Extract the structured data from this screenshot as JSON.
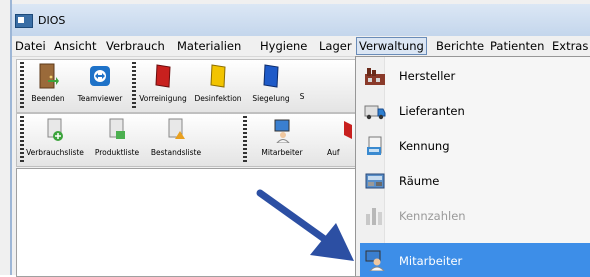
{
  "window": {
    "title": "DIOS"
  },
  "menubar": {
    "items": [
      {
        "label": "Datei"
      },
      {
        "label": "Ansicht"
      },
      {
        "label": "Verbrauch"
      },
      {
        "label": "Materialien"
      },
      {
        "label": "Hygiene"
      },
      {
        "label": "Lager"
      },
      {
        "label": "Verwaltung"
      },
      {
        "label": "Berichte"
      },
      {
        "label": "Patienten"
      },
      {
        "label": "Extras"
      }
    ],
    "active_index": 6
  },
  "toolbar1": {
    "buttons": [
      {
        "label": "Beenden",
        "icon": "door-exit-icon"
      },
      {
        "label": "Teamviewer",
        "icon": "teamviewer-icon"
      },
      {
        "label": "Vorreinigung",
        "icon": "red-book-icon"
      },
      {
        "label": "Desinfektion",
        "icon": "yellow-book-icon"
      },
      {
        "label": "Siegelung",
        "icon": "blue-book-icon"
      },
      {
        "label": "S",
        "icon": "partial-icon"
      }
    ]
  },
  "toolbar2": {
    "buttons": [
      {
        "label": "Verbrauchsliste",
        "icon": "consumption-list-icon"
      },
      {
        "label": "Produktliste",
        "icon": "product-list-icon"
      },
      {
        "label": "Bestandsliste",
        "icon": "stock-list-icon"
      },
      {
        "label": "Mitarbeiter",
        "icon": "employee-computer-icon"
      },
      {
        "label": "Auf",
        "icon": "partial-icon"
      }
    ]
  },
  "dropdown": {
    "items": [
      {
        "label": "Hersteller",
        "icon": "factory-icon",
        "enabled": true
      },
      {
        "label": "Lieferanten",
        "icon": "truck-icon",
        "enabled": true
      },
      {
        "label": "Kennung",
        "icon": "id-stack-icon",
        "enabled": true
      },
      {
        "label": "Räume",
        "icon": "rooms-icon",
        "enabled": true
      },
      {
        "label": "Kennzahlen",
        "icon": "bar-chart-icon",
        "enabled": false
      },
      {
        "label": "Mitarbeiter",
        "icon": "employee-icon",
        "enabled": true,
        "highlighted": true
      }
    ]
  },
  "colors": {
    "highlight": "#3d8ee8",
    "arrow": "#2c4fa3",
    "titlebar": "#c4d6ec"
  }
}
